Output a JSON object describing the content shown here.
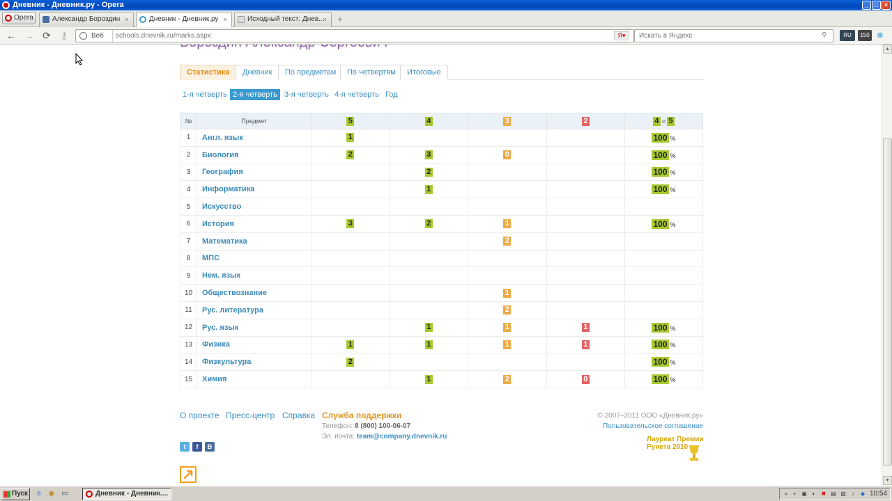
{
  "window": {
    "title": "Дневник - Дневник.ру - Opera"
  },
  "browser": {
    "opera_menu": "Opera",
    "tabs": [
      {
        "label": "Александр Бороздин"
      },
      {
        "label": "Дневник - Дневник.ру"
      },
      {
        "label": "Исходный текст: Днев..."
      }
    ],
    "address_label": "Веб",
    "url": "schools.dnevnik.ru/marks.aspx",
    "search_placeholder": "Искать в Яндекс",
    "ext_ru": "RU",
    "ext_count": "150"
  },
  "page": {
    "student_name": "Бороздин Александр Сергеевич",
    "tabs": [
      "Статистика",
      "Дневник",
      "По предметам",
      "По четвертям",
      "Итоговые"
    ],
    "quarters": [
      "1-я четверть",
      "2-я четверть",
      "3-я четверть",
      "4-я четверть",
      "Год"
    ],
    "active_quarter": "2-я четверть",
    "table": {
      "headers": {
        "num": "№",
        "subject": "Предмет",
        "g5": "5",
        "g4": "4",
        "g3": "3",
        "g2": "2",
        "g45_a": "4",
        "g45_and": "и",
        "g45_b": "5"
      },
      "percent_sign": "%",
      "rows": [
        {
          "num": "1",
          "subject": "Англ. язык",
          "g5": "1",
          "g4": "",
          "g3": "",
          "g2": "",
          "pct": "100"
        },
        {
          "num": "2",
          "subject": "Биология",
          "g5": "2",
          "g4": "3",
          "g3": "0",
          "g2": "",
          "pct": "100"
        },
        {
          "num": "3",
          "subject": "География",
          "g5": "",
          "g4": "2",
          "g3": "",
          "g2": "",
          "pct": "100"
        },
        {
          "num": "4",
          "subject": "Информатика",
          "g5": "",
          "g4": "1",
          "g3": "",
          "g2": "",
          "pct": "100"
        },
        {
          "num": "5",
          "subject": "Искусство",
          "g5": "",
          "g4": "",
          "g3": "",
          "g2": "",
          "pct": ""
        },
        {
          "num": "6",
          "subject": "История",
          "g5": "3",
          "g4": "2",
          "g3": "1",
          "g2": "",
          "pct": "100"
        },
        {
          "num": "7",
          "subject": "Математика",
          "g5": "",
          "g4": "",
          "g3": "2",
          "g2": "",
          "pct": ""
        },
        {
          "num": "8",
          "subject": "МПС",
          "g5": "",
          "g4": "",
          "g3": "",
          "g2": "",
          "pct": ""
        },
        {
          "num": "9",
          "subject": "Нем. язык",
          "g5": "",
          "g4": "",
          "g3": "",
          "g2": "",
          "pct": ""
        },
        {
          "num": "10",
          "subject": "Обществознание",
          "g5": "",
          "g4": "",
          "g3": "1",
          "g2": "",
          "pct": ""
        },
        {
          "num": "11",
          "subject": "Рус. литература",
          "g5": "",
          "g4": "",
          "g3": "2",
          "g2": "",
          "pct": ""
        },
        {
          "num": "12",
          "subject": "Рус. язык",
          "g5": "",
          "g4": "1",
          "g3": "1",
          "g2": "1",
          "pct": "100"
        },
        {
          "num": "13",
          "subject": "Физика",
          "g5": "1",
          "g4": "1",
          "g3": "1",
          "g2": "1",
          "pct": "100"
        },
        {
          "num": "14",
          "subject": "Физкультура",
          "g5": "2",
          "g4": "",
          "g3": "",
          "g2": "",
          "pct": "100"
        },
        {
          "num": "15",
          "subject": "Химия",
          "g5": "",
          "g4": "1",
          "g3": "2",
          "g2": "0",
          "pct": "100"
        }
      ]
    },
    "footer": {
      "links": [
        "О проекте",
        "Пресс-центр",
        "Справка"
      ],
      "support_title": "Служба поддержки",
      "phone_label": "Телефон:",
      "phone": "8 (800) 100-06-07",
      "email_label": "Эл. почта:",
      "email": "team@company.dnevnik.ru",
      "copyright": "© 2007–2011 ООО «Дневник.ру»",
      "agreement": "Пользовательское соглашение",
      "award_line1": "Лауреат Премии",
      "award_line2": "Рунета 2010"
    }
  },
  "taskbar": {
    "start": "Пуск",
    "task": "Дневник - Дневник....",
    "clock": "10:54"
  },
  "colors": {
    "grade5": "#a8c930",
    "grade3": "#eeaa44",
    "grade2": "#e16262",
    "link": "#3d8fc4",
    "name": "#8b58a7"
  }
}
